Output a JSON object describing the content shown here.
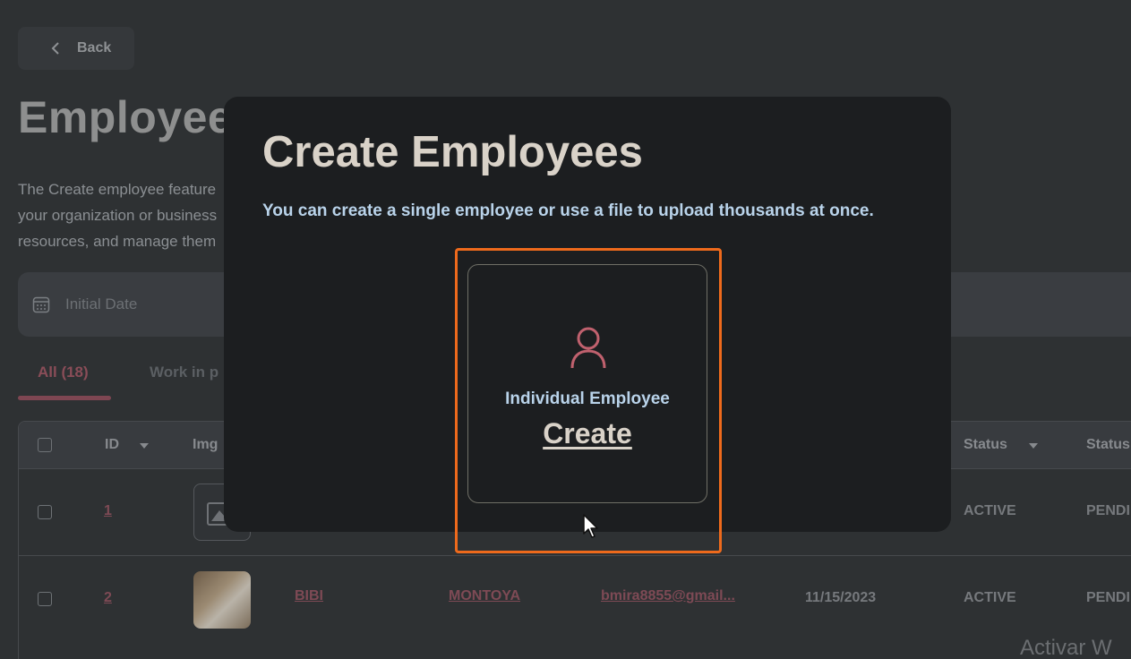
{
  "back": {
    "label": "Back"
  },
  "page": {
    "title": "Employees",
    "description": [
      "The Create employee feature",
      "your organization or business",
      "resources, and manage them"
    ]
  },
  "filter": {
    "placeholder": "Initial Date"
  },
  "tabs": {
    "all": "All (18)",
    "wip": "Work in p"
  },
  "table": {
    "headers": {
      "id": "ID",
      "img": "Img",
      "status": "Status",
      "status2": "Status"
    },
    "rows": [
      {
        "id": "1",
        "status": "ACTIVE",
        "status2": "PENDI"
      },
      {
        "id": "2",
        "first": "BIBI",
        "last": "MONTOYA",
        "email": "bmira8855@gmail...",
        "date": "11/15/2023",
        "status": "ACTIVE",
        "status2": "PENDI"
      }
    ]
  },
  "modal": {
    "title": "Create Employees",
    "description": "You can create a single employee or use a file to upload thousands at once.",
    "option": {
      "label": "Individual Employee",
      "action": "Create"
    }
  },
  "watermark": "Activar W",
  "colors": {
    "accent": "#ee6a1c",
    "link": "#7e4a55",
    "modal_bg": "#1c1e20",
    "icon": "#c0616e"
  }
}
